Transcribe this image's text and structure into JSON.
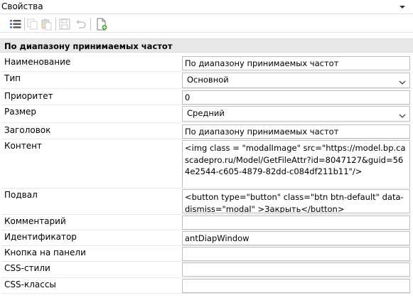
{
  "panel": {
    "title": "Свойства"
  },
  "toolbar": {
    "buttons": [
      {
        "name": "property-list-button",
        "icon": "list-icon",
        "enabled": true
      },
      {
        "name": "copy-button",
        "icon": "copy-icon",
        "enabled": false
      },
      {
        "name": "paste-button",
        "icon": "paste-icon",
        "enabled": false
      },
      {
        "name": "save-button",
        "icon": "save-icon",
        "enabled": false
      },
      {
        "name": "undo-button",
        "icon": "undo-icon",
        "enabled": false
      },
      {
        "name": "new-document-button",
        "icon": "new-document-icon",
        "enabled": true
      }
    ]
  },
  "section": {
    "title": "По диапазону принимаемых частот"
  },
  "properties": {
    "name": {
      "label": "Наименование",
      "value": "По диапазону принимаемых частот"
    },
    "type": {
      "label": "Тип",
      "value": "Основной"
    },
    "priority": {
      "label": "Приоритет",
      "value": "0"
    },
    "size": {
      "label": "Размер",
      "value": "Средний"
    },
    "heading": {
      "label": "Заголовок",
      "value": "По диапазону принимаемых частот"
    },
    "content": {
      "label": "Контент",
      "value": "<img class = \"modalImage\" src=\"https://model.bp.cascadepro.ru/Model/GetFileAttr?id=8047127&guid=564e2544-c605-4879-82dd-c084df211b11\"/>"
    },
    "footer": {
      "label": "Подвал",
      "value": "<button type=\"button\" class=\"btn btn-default\" data-dismiss=\"modal\" >Закрыть</button>"
    },
    "comment": {
      "label": "Комментарий",
      "value": ""
    },
    "identifier": {
      "label": "Идентификатор",
      "value": "antDiapWindow"
    },
    "panel_button": {
      "label": "Кнопка на панели",
      "value": ""
    },
    "css_styles": {
      "label": "CSS-стили",
      "value": ""
    },
    "css_classes": {
      "label": "CSS-классы",
      "value": ""
    }
  },
  "colors": {
    "section_bg": "#e8e8e8",
    "border": "#bdbdbd",
    "icon_blue": "#3c6fb0",
    "icon_green": "#3aa23a"
  }
}
